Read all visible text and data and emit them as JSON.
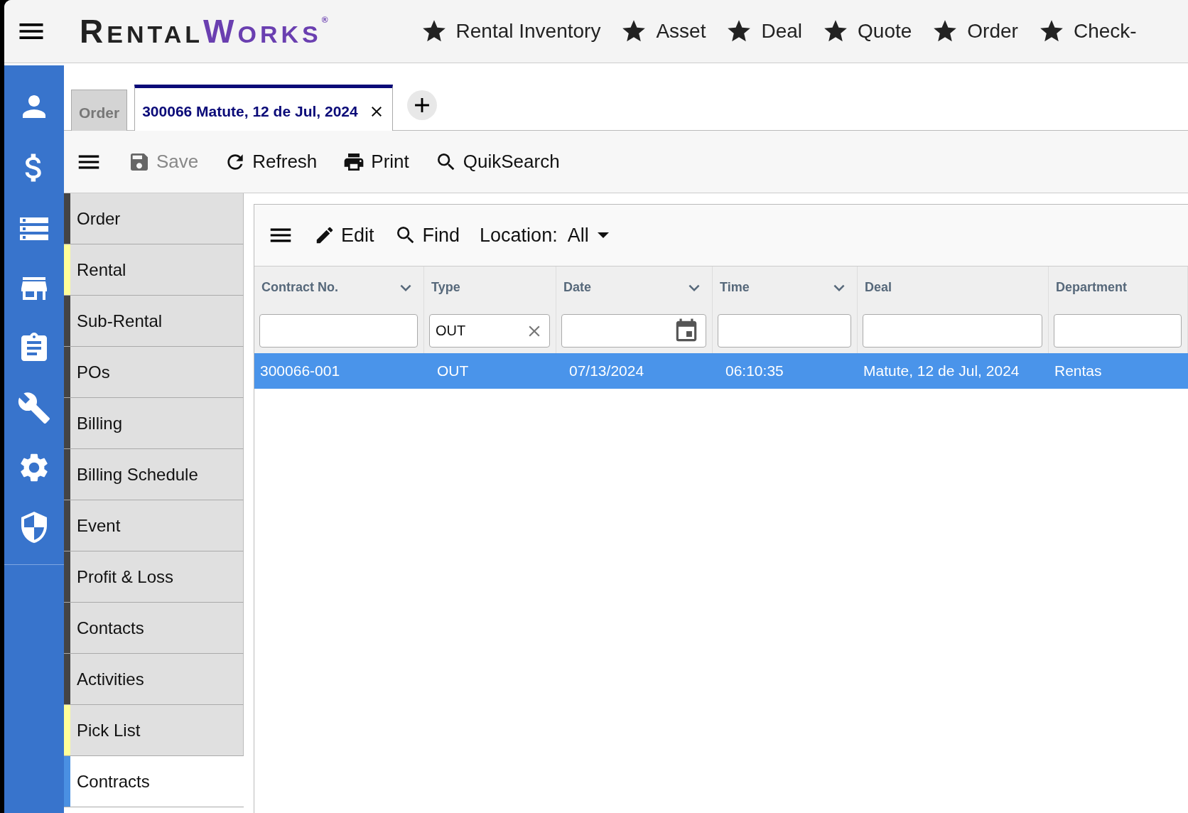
{
  "logo": {
    "name": "RENTAL",
    "accent": "WORKS",
    "mark": "®"
  },
  "favorites": [
    {
      "label": "Rental Inventory"
    },
    {
      "label": "Asset"
    },
    {
      "label": "Deal"
    },
    {
      "label": "Quote"
    },
    {
      "label": "Order"
    },
    {
      "label": "Check-"
    }
  ],
  "tabs": [
    {
      "label": "Order",
      "selected": false,
      "closable": false
    },
    {
      "label": "300066 Matute, 12 de Jul, 2024",
      "selected": true,
      "closable": true
    }
  ],
  "toolbar": [
    {
      "label": "Save",
      "disabled": true
    },
    {
      "label": "Refresh",
      "disabled": false
    },
    {
      "label": "Print",
      "disabled": false
    },
    {
      "label": "QuikSearch",
      "disabled": false
    }
  ],
  "nav": [
    {
      "label": "Order",
      "color": "#444444",
      "selected": false
    },
    {
      "label": "Rental",
      "color": "#ffff99",
      "selected": false
    },
    {
      "label": "Sub-Rental",
      "color": "#444444",
      "selected": false
    },
    {
      "label": "POs",
      "color": "#444444",
      "selected": false
    },
    {
      "label": "Billing",
      "color": "#444444",
      "selected": false
    },
    {
      "label": "Billing Schedule",
      "color": "#444444",
      "selected": false
    },
    {
      "label": "Event",
      "color": "#444444",
      "selected": false
    },
    {
      "label": "Profit & Loss",
      "color": "#444444",
      "selected": false
    },
    {
      "label": "Contacts",
      "color": "#444444",
      "selected": false
    },
    {
      "label": "Activities",
      "color": "#444444",
      "selected": false
    },
    {
      "label": "Pick List",
      "color": "#ffff99",
      "selected": false
    },
    {
      "label": "Contracts",
      "color": "#4a90e2",
      "selected": true
    }
  ],
  "grid": {
    "toolbar": {
      "edit": "Edit",
      "find": "Find",
      "location_label": "Location:",
      "location_value": "All"
    },
    "columns": [
      {
        "label": "Contract No.",
        "sortable": true,
        "kind": "text"
      },
      {
        "label": "Type",
        "sortable": false,
        "kind": "text",
        "filter": "OUT"
      },
      {
        "label": "Date",
        "sortable": true,
        "kind": "date"
      },
      {
        "label": "Time",
        "sortable": true,
        "kind": "text"
      },
      {
        "label": "Deal",
        "sortable": false,
        "kind": "text"
      },
      {
        "label": "Department",
        "sortable": false,
        "kind": "text"
      }
    ],
    "rows": [
      {
        "cells": [
          "300066-001",
          "OUT",
          "07/13/2024",
          "06:10:35",
          "Matute, 12 de Jul, 2024",
          "Rentas"
        ],
        "selected": true
      }
    ]
  }
}
